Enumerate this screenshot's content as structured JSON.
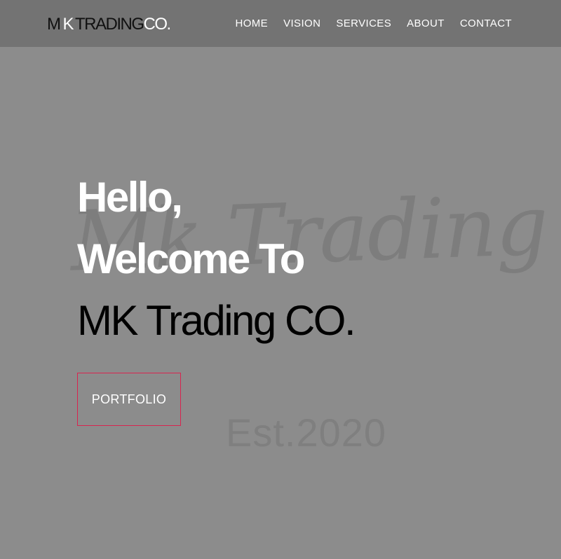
{
  "brand": {
    "part_m": "M",
    "part_k": "K",
    "part_trading": "TRADING",
    "part_co": "CO."
  },
  "nav": {
    "items": [
      {
        "label": "HOME"
      },
      {
        "label": "VISION"
      },
      {
        "label": "SERVICES"
      },
      {
        "label": "ABOUT"
      },
      {
        "label": "CONTACT"
      }
    ]
  },
  "hero": {
    "line1": "Hello,",
    "line2": "Welcome To",
    "line3": "MK Trading CO."
  },
  "cta": {
    "label": "PORTFOLIO"
  },
  "watermark": {
    "script_text": "Mk Trading Co.",
    "est_text": "Est.2020"
  },
  "colors": {
    "background": "#8c8c8c",
    "header": "#737373",
    "accent_border": "#d9244f"
  }
}
